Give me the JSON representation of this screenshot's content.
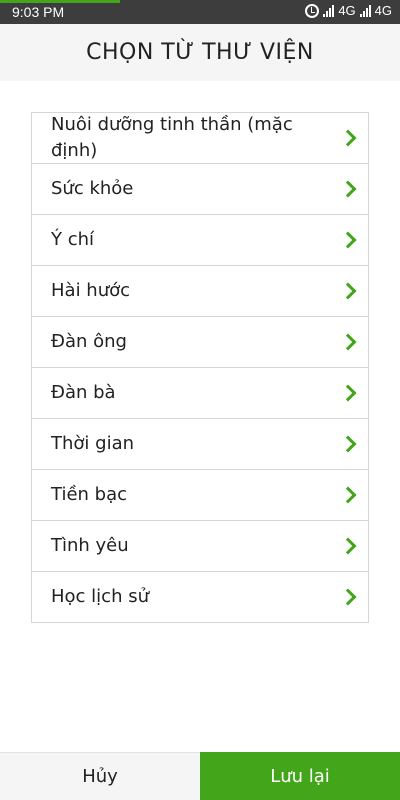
{
  "status_bar": {
    "time": "9:03  PM",
    "network_1": "4G",
    "network_2": "4G",
    "progress": 0.3
  },
  "header": {
    "title": "CHỌN TỪ THƯ VIỆN"
  },
  "list": {
    "items": [
      {
        "label": "Nuôi dưỡng tinh thần (mặc định)"
      },
      {
        "label": "Sức khỏe"
      },
      {
        "label": "Ý chí"
      },
      {
        "label": "Hài hước"
      },
      {
        "label": "Đàn ông"
      },
      {
        "label": "Đàn bà"
      },
      {
        "label": "Thời gian"
      },
      {
        "label": "Tiền bạc"
      },
      {
        "label": "Tình yêu"
      },
      {
        "label": "Học lịch sử"
      }
    ]
  },
  "footer": {
    "cancel_label": "Hủy",
    "save_label": "Lưu lại"
  },
  "colors": {
    "accent": "#42a51a",
    "status_bar": "#3d3d3d",
    "header_bg": "#f5f5f5"
  }
}
